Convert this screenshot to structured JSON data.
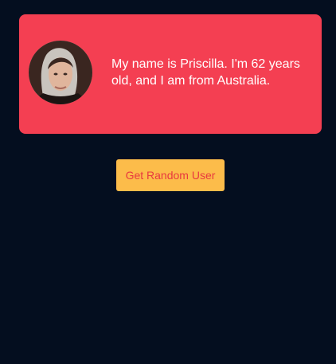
{
  "profile": {
    "bio": "My name is Priscilla. I'm 62 years old, and I am from Australia.",
    "avatar_icon": "user-portrait-photo"
  },
  "actions": {
    "random_user_label": "Get Random User"
  },
  "colors": {
    "background": "#040e1f",
    "card": "#f43f52",
    "button": "#fcbc4a",
    "button_text": "#e8393f",
    "card_text": "#ffffff"
  }
}
